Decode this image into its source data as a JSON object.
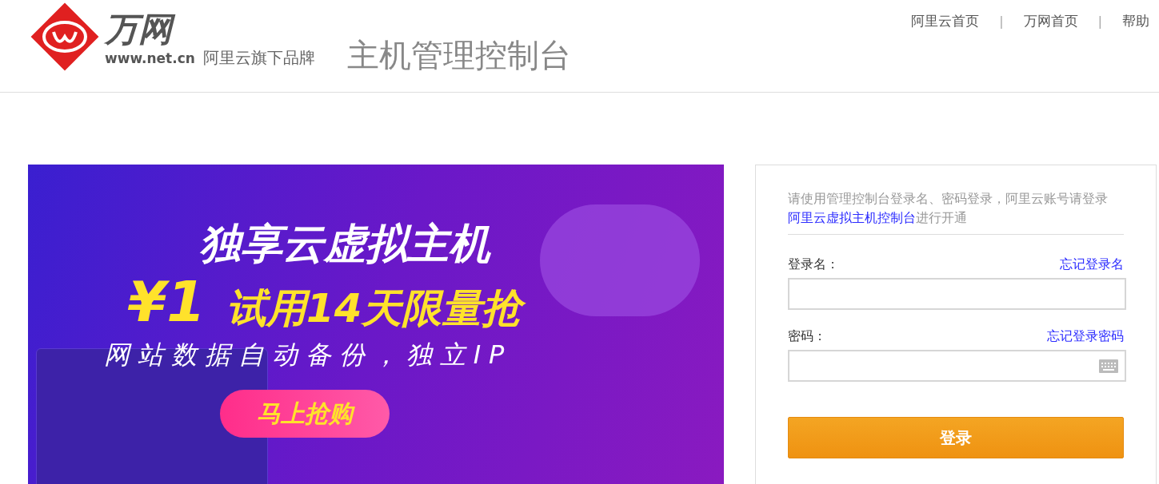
{
  "header": {
    "logo": {
      "brand": "万网",
      "url": "www.net.cn",
      "tagline": "阿里云旗下品牌"
    },
    "title": "主机管理控制台",
    "nav": [
      {
        "kind": "link",
        "label": "阿里云首页"
      },
      {
        "kind": "separator",
        "label": "|"
      },
      {
        "kind": "link",
        "label": "万网首页"
      },
      {
        "kind": "separator",
        "label": "|"
      },
      {
        "kind": "link",
        "label": "帮助"
      }
    ]
  },
  "banner": {
    "headline": "独享云虚拟主机",
    "price": "¥1",
    "offer": "试用14天限量抢",
    "features": "网站数据自动备份，独立IP",
    "button": "马上抢购"
  },
  "login": {
    "intro_before": "请使用管理控制台登录名、密码登录，阿里云账号请登录",
    "intro_link": "阿里云虚拟主机控制台",
    "intro_after": "进行开通",
    "fields": [
      {
        "kind": "text",
        "label": "登录名：",
        "forgot_link": "忘记登录名"
      },
      {
        "kind": "password",
        "label": "密码：",
        "forgot_link": "忘记登录密码"
      }
    ],
    "button": "登录"
  }
}
